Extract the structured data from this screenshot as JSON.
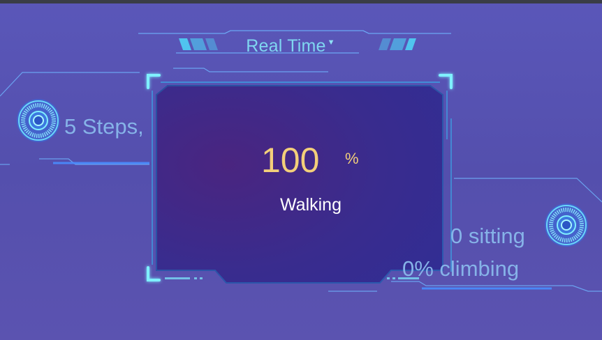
{
  "header": {
    "title": "Real Time",
    "dropdown_icon": "caret-down-icon"
  },
  "left_panel": {
    "steps_text": "5 Steps,",
    "icon": "radial-gauge-icon"
  },
  "card": {
    "value": "100",
    "unit": "%",
    "activity": "Walking"
  },
  "right_panel": {
    "sitting_text": "0 sitting",
    "climbing_text": "0% climbing",
    "icon": "radial-gauge-icon"
  },
  "colors": {
    "background": "#5a57b9",
    "card_inner": "#3a2a8c",
    "accent_cyan": "#6fe3ff",
    "value_gold": "#f3cf7a",
    "text_blue": "#86b3e8"
  }
}
